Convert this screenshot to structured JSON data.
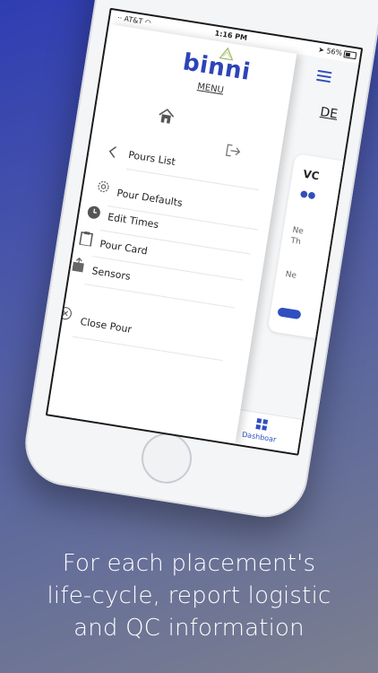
{
  "status": {
    "carrier": "·· AT&T ◠",
    "time": "1:16 PM",
    "battery": "➤ 56%"
  },
  "drawer": {
    "logo": "binni",
    "menu_label": "MENU",
    "items": [
      {
        "label": "Pours List",
        "icon": "chevron-left-icon"
      },
      {
        "label": "Pour Defaults",
        "icon": "gear-icon"
      },
      {
        "label": "Edit Times",
        "icon": "clock-icon"
      },
      {
        "label": "Pour Card",
        "icon": "clipboard-icon"
      },
      {
        "label": "Sensors",
        "icon": "upload-box-icon"
      },
      {
        "label": "Close Pour",
        "icon": "close-circle-icon"
      }
    ]
  },
  "dashboard": {
    "title_fragment": "DE",
    "card_title_fragment": "VC",
    "card_text_1": "Ne",
    "card_text_2": "Th",
    "card_text_3": "Ne",
    "tab_label": "Dashboar"
  },
  "caption": {
    "line1": "For each placement's",
    "line2": "life-cycle, report logistic",
    "line3": "and QC information"
  },
  "colors": {
    "brand": "#2d44b8",
    "accent": "#2f4fc0"
  }
}
